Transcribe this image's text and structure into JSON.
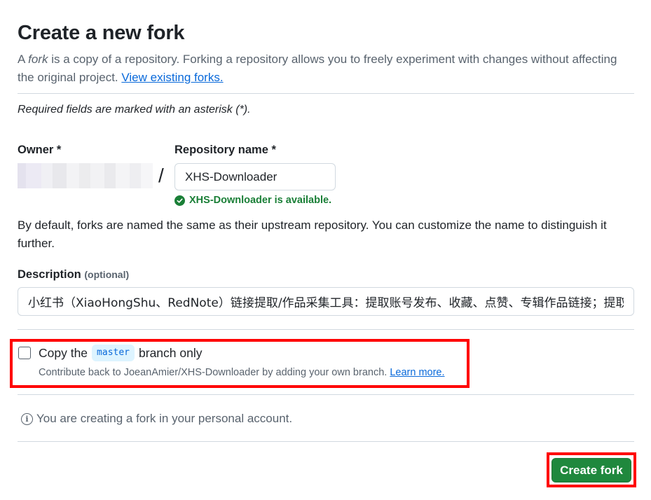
{
  "header": {
    "title": "Create a new fork",
    "lead_prefix": "A ",
    "lead_em": "fork",
    "lead_rest": " is a copy of a repository. Forking a repository allows you to freely experiment with changes without affecting the original project. ",
    "view_forks_link": "View existing forks."
  },
  "form": {
    "required_note": "Required fields are marked with an asterisk (*).",
    "owner_label": "Owner *",
    "slash": "/",
    "repo_name_label": "Repository name *",
    "repo_name_value": "XHS-Downloader",
    "availability_message": "XHS-Downloader is available.",
    "default_note": "By default, forks are named the same as their upstream repository. You can customize the name to distinguish it further.",
    "description_label": "Description",
    "description_optional": "(optional)",
    "description_value": "小红书（XiaoHongShu、RedNote）链接提取/作品采集工具：提取账号发布、收藏、点赞、专辑作品链接；提取搜索结果作品、用户链接；采集小红书作品信息；提取小红书作品下载地址；下载小红书无水印作品文件",
    "copy_branch": {
      "checked": false,
      "label_before": "Copy the",
      "branch_name": "master",
      "label_after": "branch only",
      "hint": "Contribute back to JoeanAmier/XHS-Downloader by adding your own branch.",
      "learn_more_link": "Learn more."
    },
    "account_note": "You are creating a fork in your personal account.",
    "submit_label": "Create fork"
  },
  "icons": {
    "availability": "check-circle-icon",
    "info": "info-icon"
  },
  "colors": {
    "success": "#1a7f37",
    "link": "#0969da",
    "primary_button": "#1f883d",
    "highlight": "#ff0000"
  }
}
